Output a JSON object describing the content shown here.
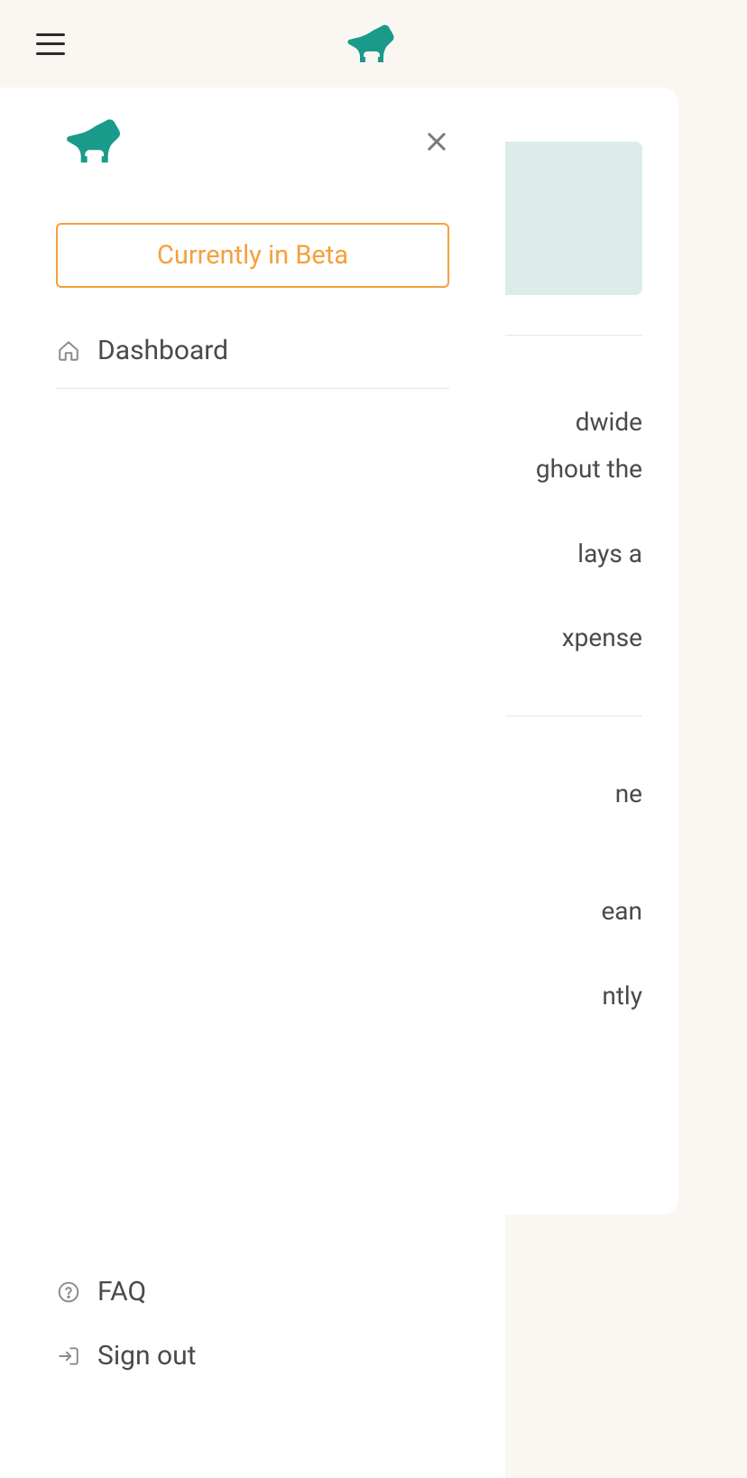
{
  "sidebar": {
    "beta_label": "Currently in Beta",
    "items": [
      {
        "label": "Dashboard",
        "icon": "home-icon"
      }
    ],
    "footer_items": [
      {
        "label": "FAQ",
        "icon": "help-circle-icon"
      },
      {
        "label": "Sign out",
        "icon": "log-out-icon"
      }
    ]
  },
  "content": {
    "fragments": {
      "line1": "dwide",
      "line2": "ghout the",
      "line3": "lays a",
      "line4": "xpense",
      "line5": "ne",
      "line6": "ean",
      "line7": "ntly"
    }
  }
}
